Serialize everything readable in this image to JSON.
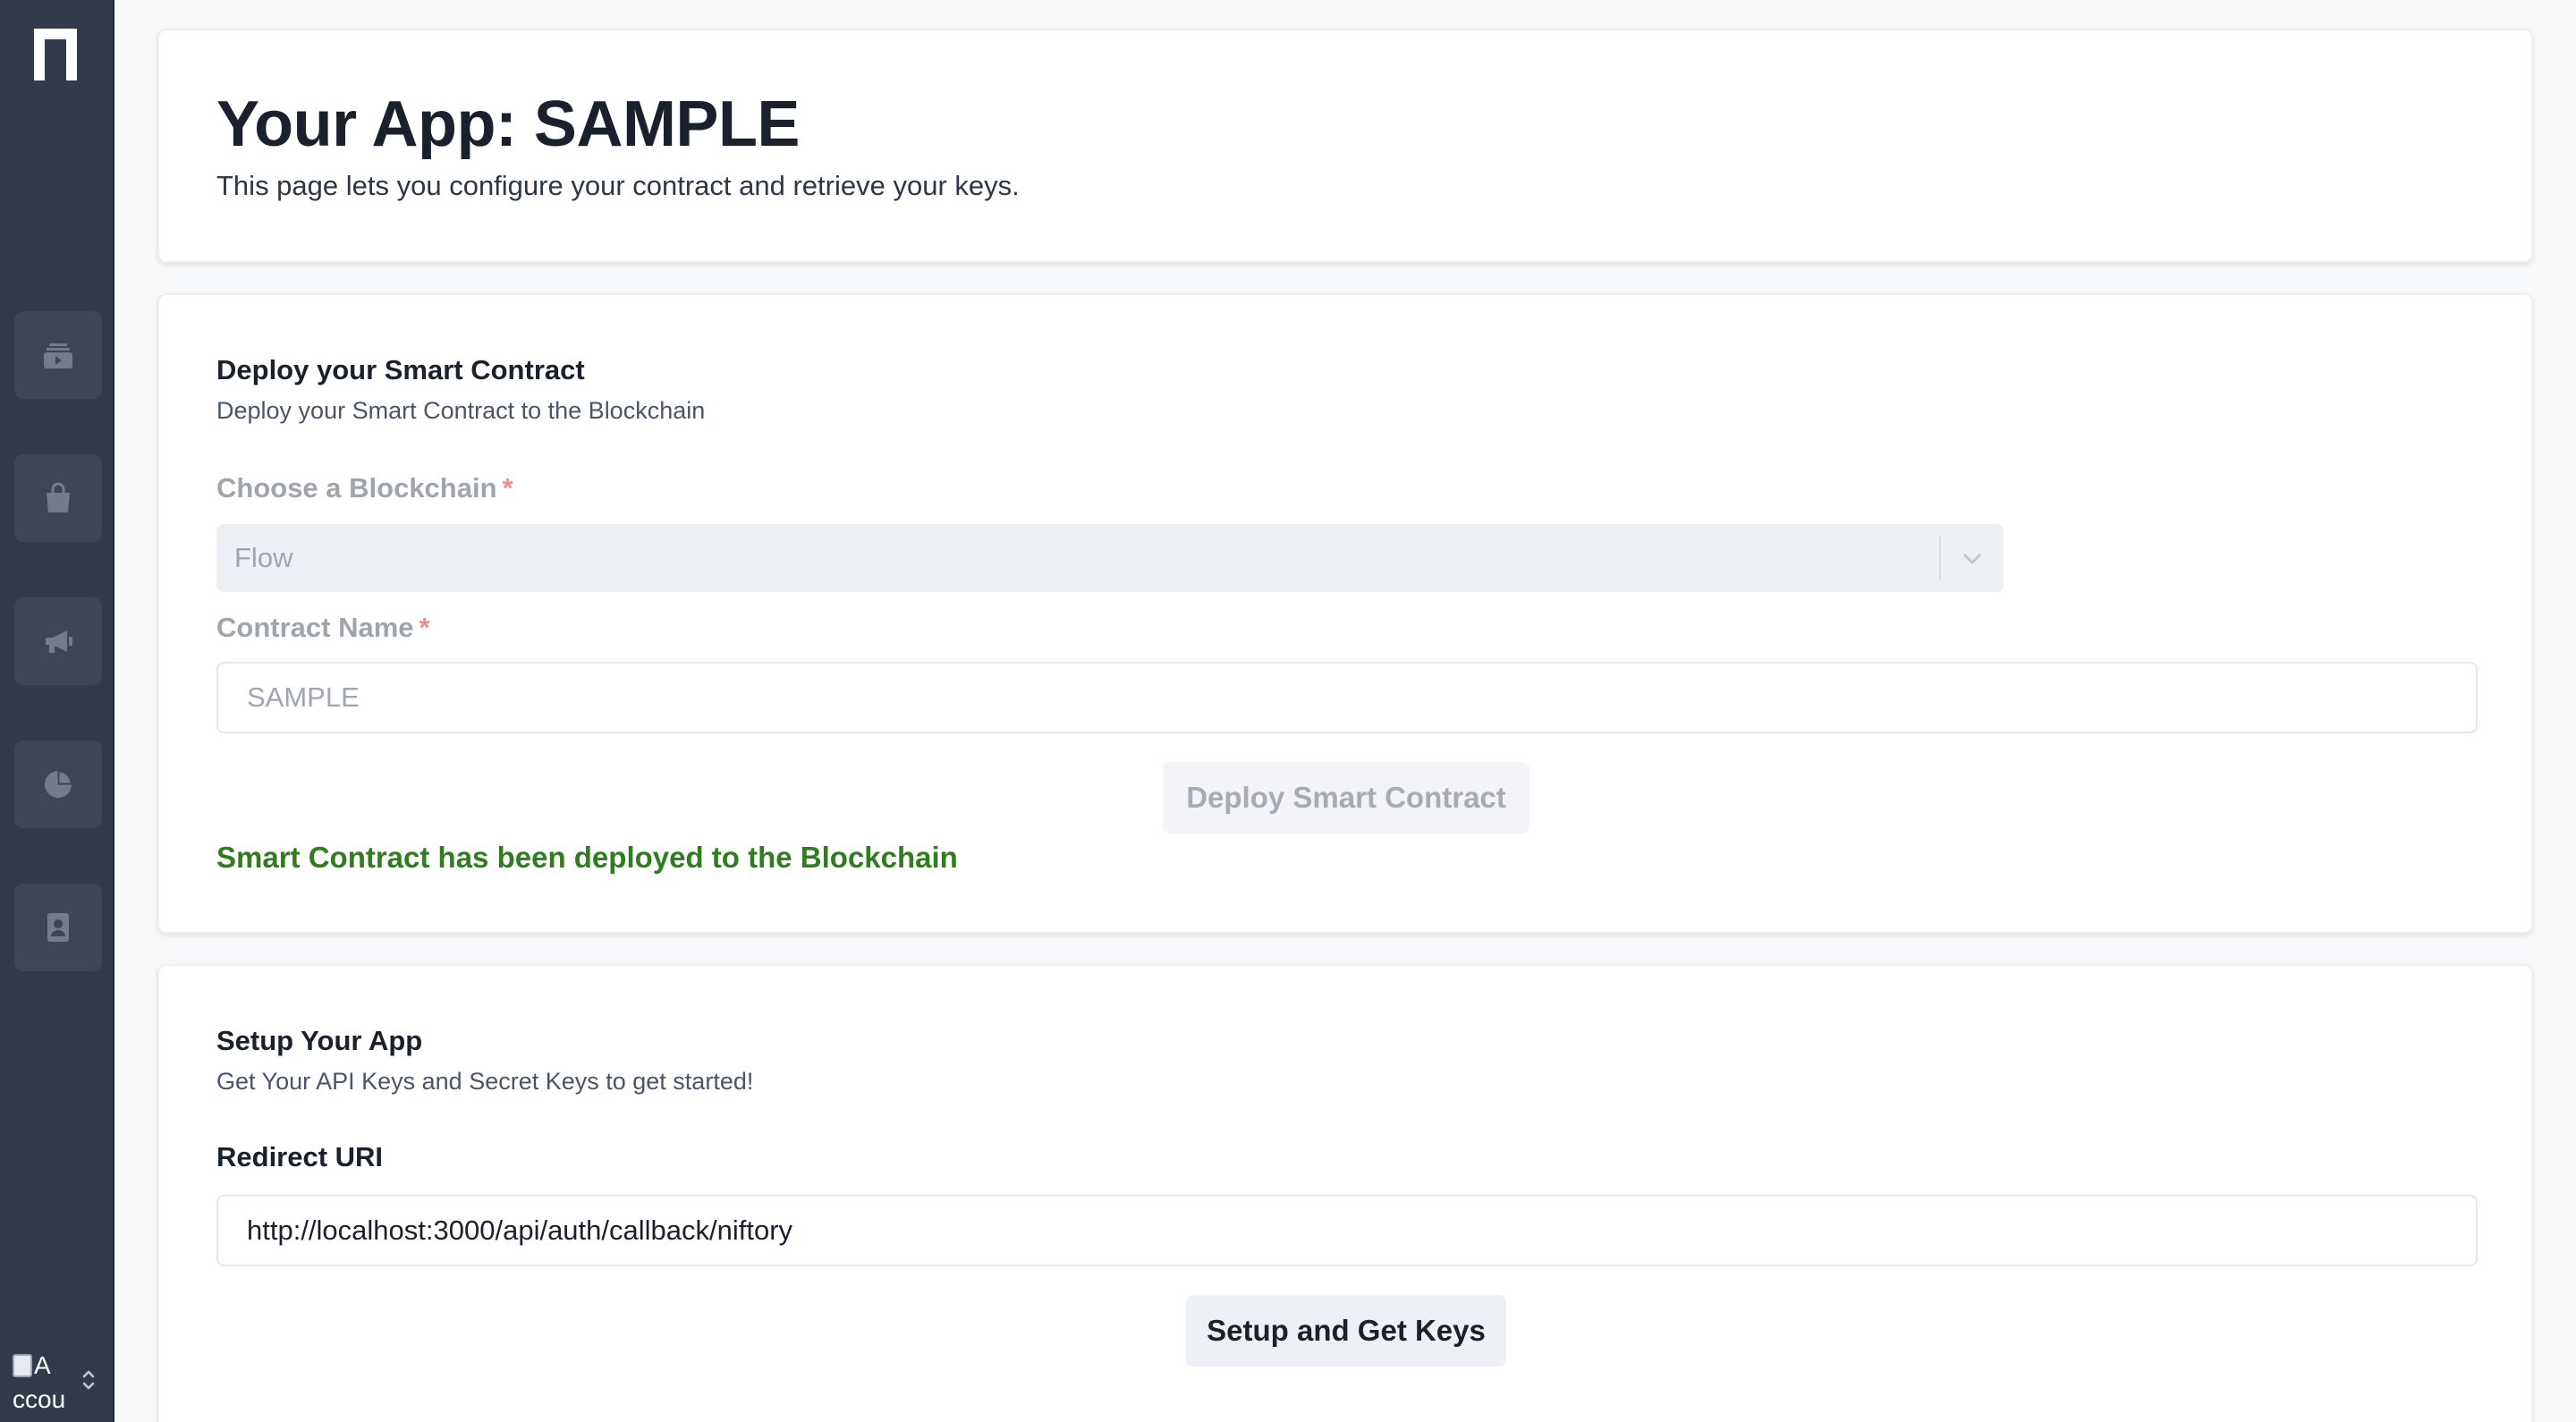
{
  "sidebar": {
    "logo_icon": "niftory-logo-icon",
    "nav_items": [
      {
        "icon": "ticket-icon",
        "name": "nav-collectibles"
      },
      {
        "icon": "shopping-bag-icon",
        "name": "nav-store"
      },
      {
        "icon": "megaphone-icon",
        "name": "nav-campaigns"
      },
      {
        "icon": "pie-chart-icon",
        "name": "nav-analytics"
      },
      {
        "icon": "id-badge-icon",
        "name": "nav-account"
      }
    ],
    "account": {
      "image_alt": "Accou",
      "alt_line1": "A",
      "alt_line2": "ccou"
    },
    "background_color": "#323b4b"
  },
  "header": {
    "title": "Your App: SAMPLE",
    "subtitle": "This page lets you configure your contract and retrieve your keys."
  },
  "deploy_section": {
    "title": "Deploy your Smart Contract",
    "description": "Deploy your Smart Contract to the Blockchain",
    "blockchain_label": "Choose a Blockchain",
    "required_marker": "*",
    "blockchain_value": "Flow",
    "contract_label": "Contract Name",
    "contract_value": "SAMPLE",
    "deploy_button_label": "Deploy Smart Contract",
    "success_message": "Smart Contract has been deployed to the Blockchain",
    "success_color": "#2f7d1f"
  },
  "setup_section": {
    "title": "Setup Your App",
    "description": "Get Your API Keys and Secret Keys to get started!",
    "redirect_label": "Redirect URI",
    "redirect_value": "http://localhost:3000/api/auth/callback/niftory",
    "setup_button_label": "Setup and Get Keys"
  }
}
